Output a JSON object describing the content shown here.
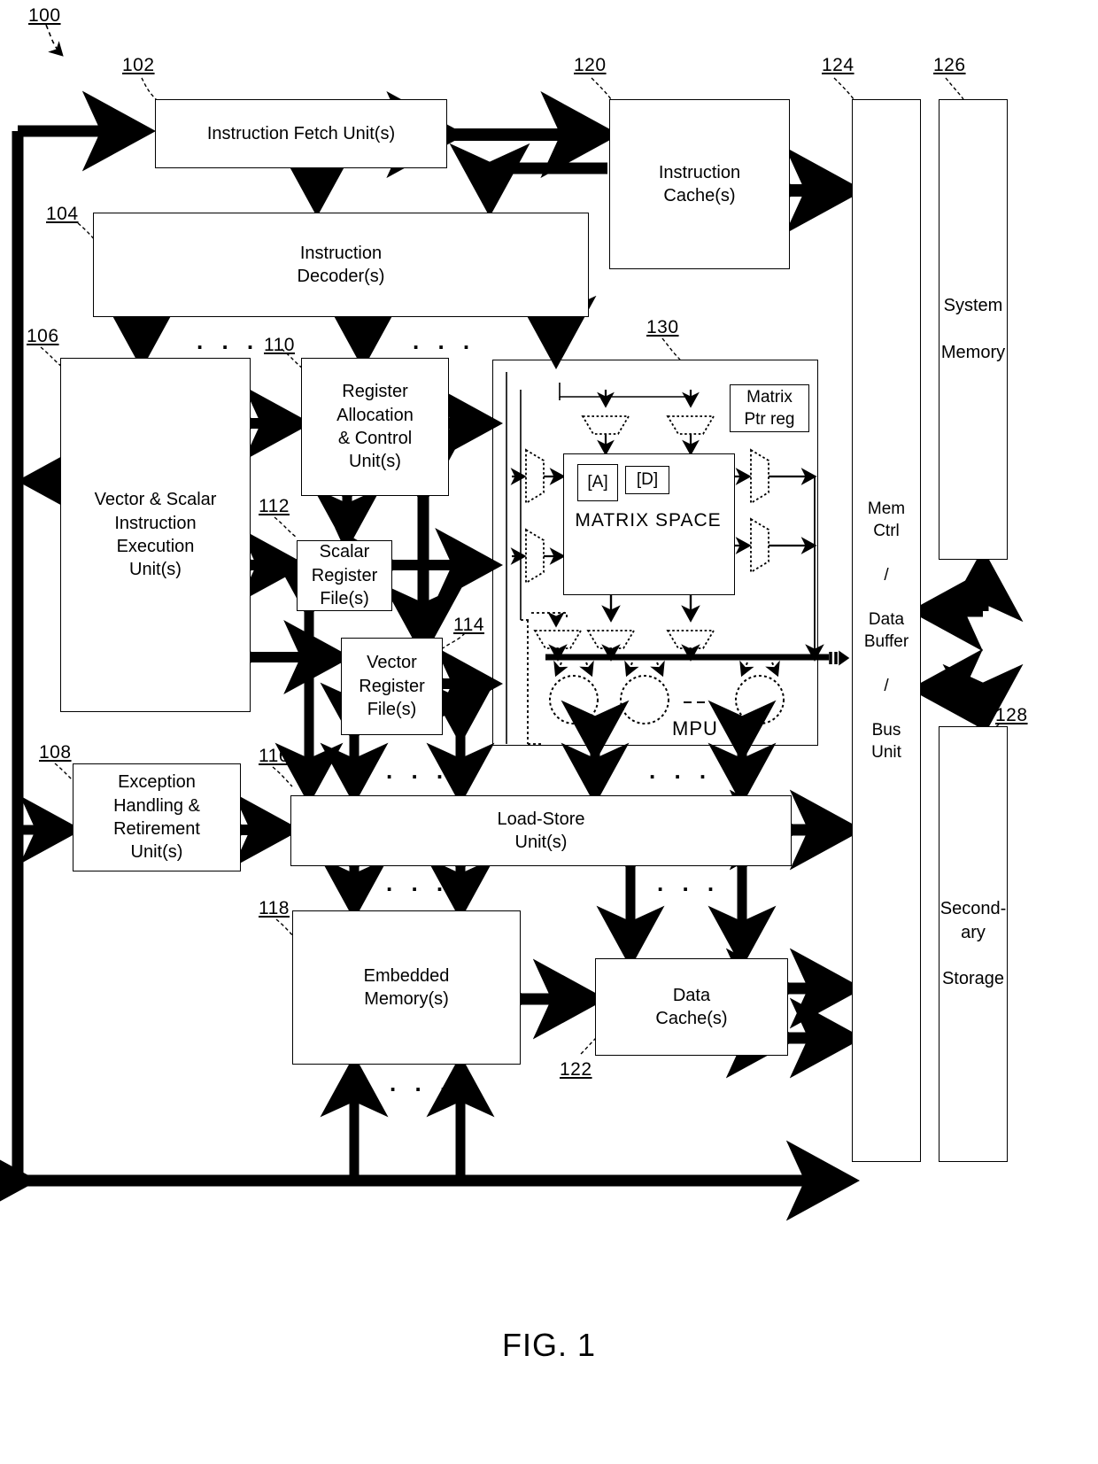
{
  "figure": {
    "caption": "FIG. 1",
    "system_ref": "100"
  },
  "blocks": [
    {
      "id": "instruction_fetch",
      "ref": "102",
      "label": "Instruction Fetch Unit(s)"
    },
    {
      "id": "instruction_decoder",
      "ref": "104",
      "label": "Instruction\nDecoder(s)"
    },
    {
      "id": "vector_scalar_exec",
      "ref": "106",
      "label": "Vector & Scalar\nInstruction\nExecution\nUnit(s)"
    },
    {
      "id": "exception_handling",
      "ref": "108",
      "label": "Exception\nHandling &\nRetirement\nUnit(s)"
    },
    {
      "id": "register_allocation",
      "ref": "110",
      "label": "Register\nAllocation\n&  Control\nUnit(s)"
    },
    {
      "id": "scalar_register_file",
      "ref": "112",
      "label": "Scalar\nRegister\nFile(s)"
    },
    {
      "id": "vector_register_file",
      "ref": "114",
      "label": "Vector\nRegister\nFile(s)"
    },
    {
      "id": "load_store",
      "ref": "116",
      "label": "Load-Store\nUnit(s)"
    },
    {
      "id": "embedded_memory",
      "ref": "118",
      "label": "Embedded\nMemory(s)"
    },
    {
      "id": "instruction_cache",
      "ref": "120",
      "label": "Instruction\nCache(s)"
    },
    {
      "id": "data_cache",
      "ref": "122",
      "label": "Data\nCache(s)"
    },
    {
      "id": "mem_ctrl_bus",
      "ref": "124",
      "label": "Mem\nCtrl\n\n/\n\nData\nBuffer\n\n/\n\nBus\nUnit"
    },
    {
      "id": "system_memory",
      "ref": "126",
      "label": "System\n\nMemory"
    },
    {
      "id": "secondary_storage",
      "ref": "128",
      "label": "Second-\nary\n\nStorage"
    },
    {
      "id": "mpu",
      "ref": "130",
      "label": "MPU"
    }
  ],
  "mpu": {
    "ref": "130",
    "name": "MPU",
    "matrix_space_label": "MATRIX SPACE",
    "matrix_ptr_reg_label": "Matrix\nPtr reg",
    "operand_a": "[A]",
    "operand_d": "[D]",
    "ellipsis": "---"
  },
  "mem_ctrl": {
    "line1": "Mem",
    "line2": "Ctrl",
    "sep1": "/",
    "line3": "Data",
    "line4": "Buffer",
    "sep2": "/",
    "line5": "Bus",
    "line6": "Unit"
  },
  "system_memory": {
    "line1": "System",
    "line2": "Memory"
  },
  "secondary_storage": {
    "line1": "Second-",
    "line2": "ary",
    "line3": "Storage"
  },
  "ellipses": {
    "e1": ". . .",
    "e2": ". . .",
    "e3": ". . .",
    "e4": ". . .",
    "e5": ". . .",
    "e6": ". . .",
    "e7": ". . .",
    "e8": ". . ."
  },
  "colors": {
    "stroke": "#000000",
    "background": "#ffffff"
  }
}
